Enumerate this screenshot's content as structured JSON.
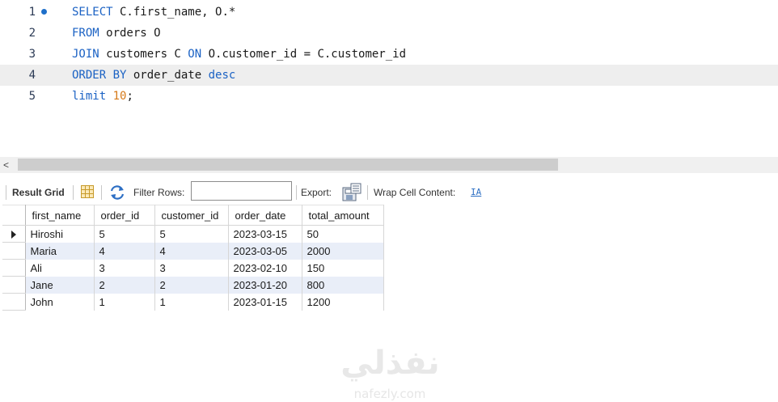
{
  "editor": {
    "lines": [
      {
        "num": "1",
        "tokens": [
          {
            "t": "SELECT",
            "k": "kw"
          },
          {
            "t": " C.first_name, O.*",
            "k": ""
          }
        ]
      },
      {
        "num": "2",
        "tokens": [
          {
            "t": "FROM",
            "k": "kw"
          },
          {
            "t": " orders O",
            "k": ""
          }
        ]
      },
      {
        "num": "3",
        "tokens": [
          {
            "t": "JOIN",
            "k": "kw"
          },
          {
            "t": " customers C ",
            "k": ""
          },
          {
            "t": "ON",
            "k": "kw"
          },
          {
            "t": " O.customer_id = C.customer_id",
            "k": ""
          }
        ]
      },
      {
        "num": "4",
        "tokens": [
          {
            "t": "ORDER BY",
            "k": "kw"
          },
          {
            "t": " order_date ",
            "k": ""
          },
          {
            "t": "desc",
            "k": "kw"
          }
        ]
      },
      {
        "num": "5",
        "tokens": [
          {
            "t": "limit",
            "k": "kw"
          },
          {
            "t": " ",
            "k": ""
          },
          {
            "t": "10",
            "k": "num"
          },
          {
            "t": ";",
            "k": ""
          }
        ]
      }
    ],
    "current_line": 4,
    "colors": {
      "keyword": "#1b62c4",
      "number": "#d67a1a",
      "marker": "#1e6fc9"
    }
  },
  "scrollbar": {
    "left_arrow": "<"
  },
  "toolbar": {
    "result_grid_label": "Result Grid",
    "filter_rows_label": "Filter Rows:",
    "filter_value": "",
    "export_label": "Export:",
    "wrap_label": "Wrap Cell Content:",
    "wrap_icon_glyph": "IA"
  },
  "grid": {
    "columns": [
      "first_name",
      "order_id",
      "customer_id",
      "order_date",
      "total_amount"
    ],
    "rows": [
      [
        "Hiroshi",
        "5",
        "5",
        "2023-03-15",
        "50"
      ],
      [
        "Maria",
        "4",
        "4",
        "2023-03-05",
        "2000"
      ],
      [
        "Ali",
        "3",
        "3",
        "2023-02-10",
        "150"
      ],
      [
        "Jane",
        "2",
        "2",
        "2023-01-20",
        "800"
      ],
      [
        "John",
        "1",
        "1",
        "2023-01-15",
        "1200"
      ]
    ],
    "alt_row_color": "#e9eef8"
  },
  "watermark": {
    "arabic": "نفذلي",
    "url": "nafezly.com"
  }
}
